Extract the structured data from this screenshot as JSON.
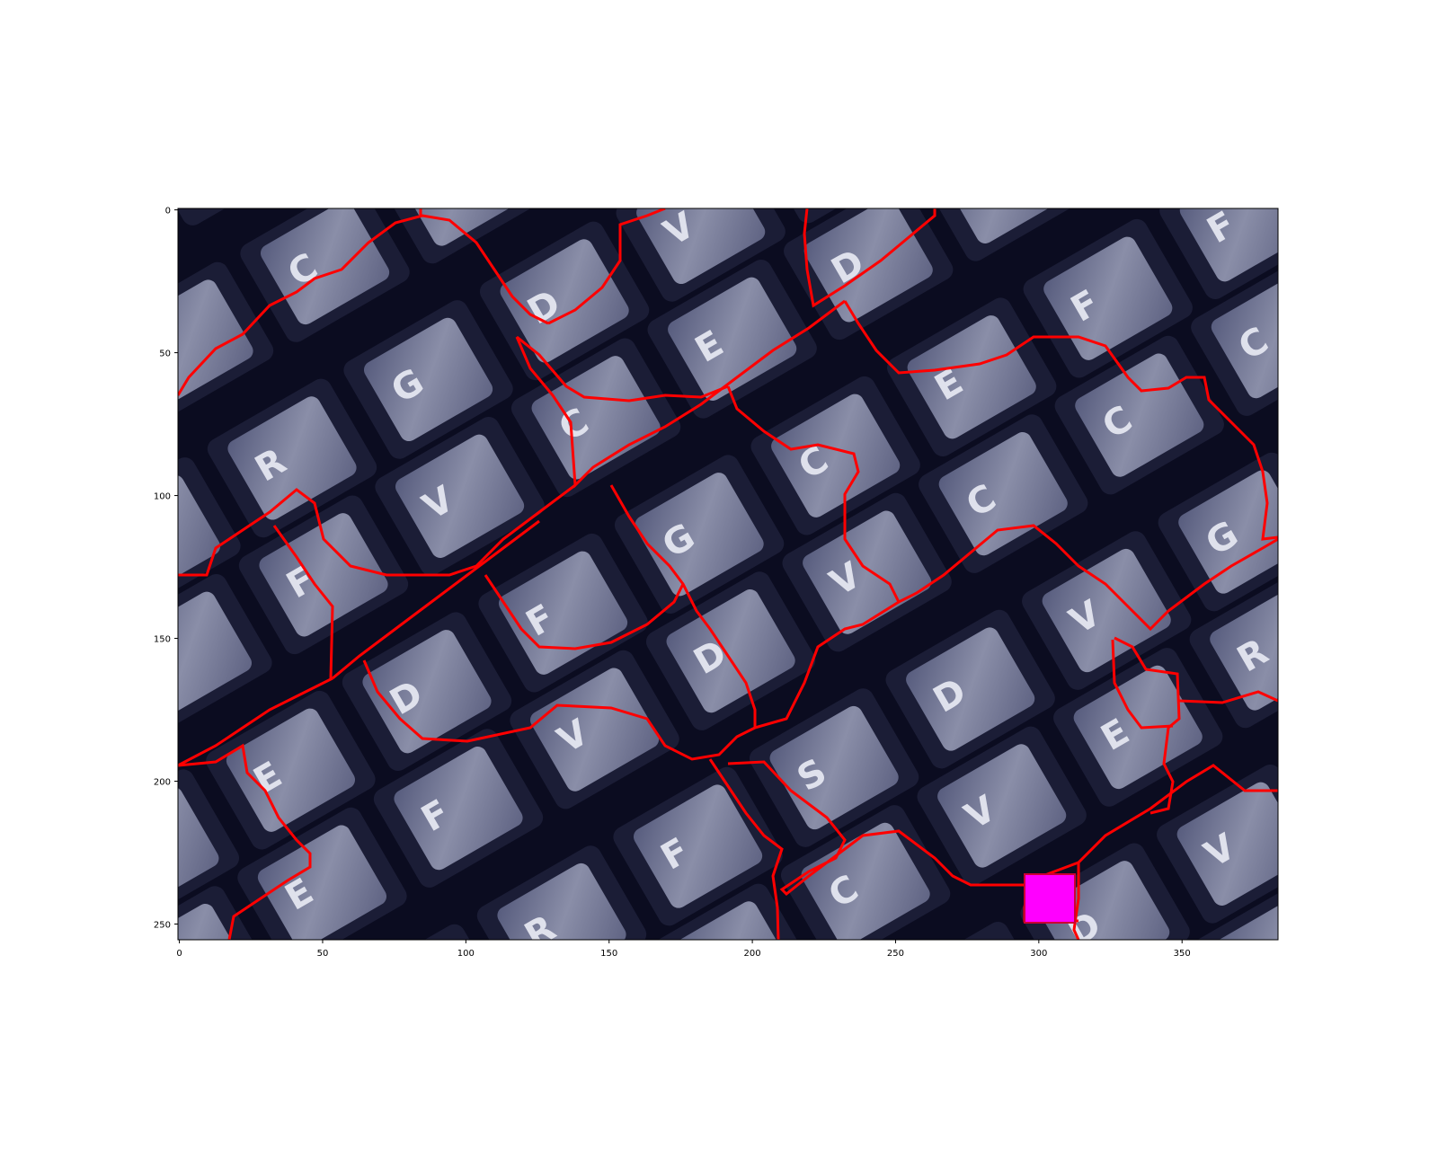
{
  "figure": {
    "x_tick_labels": [
      "0",
      "50",
      "100",
      "150",
      "200",
      "250",
      "300",
      "350"
    ],
    "y_tick_labels": [
      "0",
      "50",
      "100",
      "150",
      "200",
      "250"
    ]
  },
  "image": {
    "description_icon": "keyboard-photo",
    "key_letters": [
      "G",
      "F",
      "C",
      "V",
      "E",
      "R",
      "G",
      "D",
      "V",
      "E",
      "F",
      "F",
      "V",
      "C",
      "E",
      "D",
      "V",
      "V",
      "E",
      "D",
      "F",
      "G",
      "C",
      "E",
      "F",
      "F",
      "D",
      "E",
      "F",
      "V",
      "D",
      "V",
      "C",
      "C",
      "C",
      "E",
      "R",
      "F",
      "S",
      "D",
      "V"
    ],
    "colors": {
      "background": "#0b0c20",
      "keycap": "#6f7390",
      "boundary": "#ff0000",
      "marker": "#ff00ff"
    }
  }
}
